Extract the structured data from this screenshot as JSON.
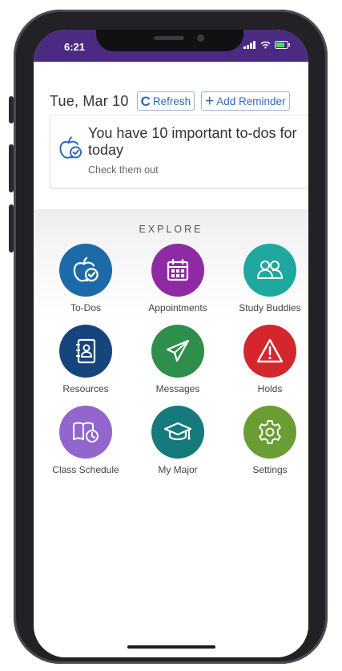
{
  "status_bar": {
    "time": "6:21",
    "bg_color": "#4b2a82"
  },
  "header": {
    "date": "Tue, Mar 10",
    "refresh_label": "Refresh",
    "add_reminder_label": "Add Reminder",
    "accent_color": "#2f6ab5"
  },
  "todo_card": {
    "title": "You have 10 important to-dos for today",
    "subtitle": "Check them out",
    "icon": "apple-check-icon"
  },
  "explore": {
    "title": "EXPLORE",
    "tiles": [
      {
        "label": "To-Dos",
        "icon": "apple-check-icon",
        "color": "#1c6aa8"
      },
      {
        "label": "Appointments",
        "icon": "calendar-icon",
        "color": "#8e2aa3"
      },
      {
        "label": "Study Buddies",
        "icon": "people-icon",
        "color": "#1fa8a0"
      },
      {
        "label": "Resources",
        "icon": "address-book-icon",
        "color": "#16447c"
      },
      {
        "label": "Messages",
        "icon": "paper-plane-icon",
        "color": "#2e8e4c"
      },
      {
        "label": "Holds",
        "icon": "warning-icon",
        "color": "#d4262c"
      },
      {
        "label": "Class Schedule",
        "icon": "book-clock-icon",
        "color": "#9266cc"
      },
      {
        "label": "My Major",
        "icon": "graduation-cap-icon",
        "color": "#167a7d"
      },
      {
        "label": "Settings",
        "icon": "gear-icon",
        "color": "#6a9d33"
      }
    ]
  }
}
